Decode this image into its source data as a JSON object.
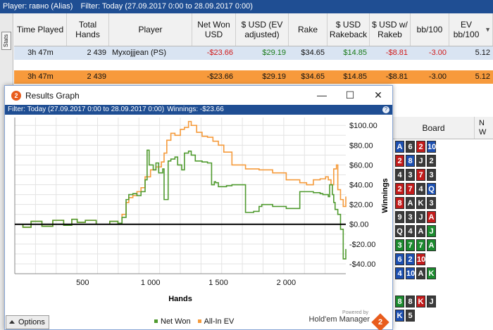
{
  "top_bar": {
    "player": "Player: гавно (Alias)",
    "filter": "Filter: Today (27.09.2017 0:00 to 28.09.2017 0:00)"
  },
  "side_tab": {
    "label": "Stats"
  },
  "stats_table": {
    "headers": [
      "Time Played",
      "Total Hands",
      "Player",
      "Net Won USD",
      "$ USD (EV adjusted)",
      "Rake",
      "$ USD Rakeback",
      "$ USD w/ Rakeb",
      "bb/100",
      "EV bb/100"
    ],
    "row": {
      "time": "3h 47m",
      "hands": "2 439",
      "player": "Myxojjjean (PS)",
      "net": "-$23.66",
      "ev": "$29.19",
      "rake": "$34.65",
      "rakeback": "$14.85",
      "with_rb": "-$8.81",
      "bb100": "-3.00",
      "evbb100": "5.12"
    },
    "total": {
      "time": "3h 47m",
      "hands": "2 439",
      "net": "-$23.66",
      "ev": "$29.19",
      "rake": "$34.65",
      "rakeback": "$14.85",
      "with_rb": "-$8.81",
      "bb100": "-3.00",
      "evbb100": "5.12"
    }
  },
  "board_panel": {
    "header": "Board",
    "header2": "N W",
    "rows": [
      [
        [
          "A",
          "d"
        ],
        [
          "6",
          "s"
        ],
        [
          "2",
          "h"
        ],
        [
          "10",
          "d"
        ]
      ],
      [
        [
          "2",
          "h"
        ],
        [
          "8",
          "d"
        ],
        [
          "J",
          "s"
        ],
        [
          "2",
          "s"
        ]
      ],
      [
        [
          "4",
          "s"
        ],
        [
          "3",
          "s"
        ],
        [
          "7",
          "h"
        ],
        [
          "3",
          "s"
        ]
      ],
      [
        [
          "2",
          "h"
        ],
        [
          "7",
          "h"
        ],
        [
          "4",
          "s"
        ],
        [
          "Q",
          "d"
        ]
      ],
      [
        [
          "8",
          "h"
        ],
        [
          "A",
          "s"
        ],
        [
          "K",
          "s"
        ],
        [
          "3",
          "s"
        ]
      ],
      [
        [
          "9",
          "s"
        ],
        [
          "3",
          "s"
        ],
        [
          "J",
          "s"
        ],
        [
          "A",
          "h"
        ]
      ],
      [
        [
          "Q",
          "s"
        ],
        [
          "4",
          "s"
        ],
        [
          "A",
          "s"
        ],
        [
          "J",
          "c"
        ]
      ],
      [
        [
          "3",
          "c"
        ],
        [
          "7",
          "c"
        ],
        [
          "7",
          "c"
        ],
        [
          "A",
          "c"
        ]
      ],
      [
        [
          "6",
          "d"
        ],
        [
          "2",
          "d"
        ],
        [
          "10",
          "h"
        ],
        [
          "",
          ""
        ]
      ],
      [
        [
          "4",
          "d"
        ],
        [
          "10",
          "d"
        ],
        [
          "A",
          "s"
        ],
        [
          "K",
          "c"
        ]
      ],
      [
        [
          "",
          ""
        ],
        [
          "",
          ""
        ],
        [
          "",
          ""
        ],
        [
          "",
          ""
        ]
      ],
      [
        [
          "8",
          "c"
        ],
        [
          "8",
          "s"
        ],
        [
          "K",
          "h"
        ],
        [
          "J",
          "s"
        ]
      ],
      [
        [
          "K",
          "d"
        ],
        [
          "5",
          "s"
        ],
        [
          "",
          ""
        ],
        [
          "",
          ""
        ]
      ]
    ]
  },
  "graph_window": {
    "title": "Results Graph",
    "filter": "Filter: Today (27.09.2017 0:00 to 28.09.2017 0:00)",
    "winnings": "Winnings: -$23.66",
    "help": "?",
    "controls": {
      "minimize": "—",
      "maximize": "☐",
      "close": "✕"
    },
    "options_label": "Options",
    "legend": {
      "net_won": "Net Won",
      "all_in_ev": "All-In EV"
    },
    "powered_by": "Powered by",
    "brand": "Hold'em Manager",
    "colors": {
      "net_won": "#4f9a2e",
      "all_in_ev": "#f59a3a"
    }
  },
  "chart_data": {
    "type": "line",
    "xlabel": "Hands",
    "ylabel": "Winnings",
    "xlim": [
      0,
      2439
    ],
    "ylim": [
      -50,
      108
    ],
    "x_ticks": [
      500,
      1000,
      1500,
      2000
    ],
    "x_tick_labels": [
      "500",
      "1 000",
      "1 500",
      "2 000"
    ],
    "y_ticks": [
      -40,
      -20,
      0,
      20,
      40,
      60,
      80,
      100
    ],
    "y_tick_labels": [
      "-$40.00",
      "-$20.00",
      "$0.00",
      "$20.00",
      "$40.00",
      "$60.00",
      "$80.00",
      "$100.00"
    ],
    "series": [
      {
        "name": "Net Won",
        "color": "#4f9a2e",
        "x": [
          0,
          60,
          120,
          200,
          280,
          360,
          420,
          460,
          520,
          600,
          700,
          760,
          790,
          820,
          840,
          870,
          900,
          930,
          960,
          975,
          990,
          1000,
          1020,
          1040,
          1060,
          1090,
          1100,
          1130,
          1150,
          1180,
          1200,
          1230,
          1250,
          1280,
          1300,
          1330,
          1380,
          1420,
          1450,
          1470,
          1480,
          1500,
          1540,
          1560,
          1600,
          1640,
          1700,
          1760,
          1800,
          1820,
          1900,
          2000,
          2100,
          2200,
          2250,
          2270,
          2290,
          2310,
          2320,
          2340,
          2350,
          2360,
          2380,
          2400,
          2420,
          2439
        ],
        "values": [
          0,
          -3,
          3,
          -2,
          4,
          -1,
          5,
          2,
          4,
          0,
          3,
          1,
          7,
          25,
          30,
          31,
          29,
          33,
          45,
          75,
          60,
          60,
          55,
          62,
          52,
          56,
          25,
          64,
          66,
          68,
          60,
          55,
          72,
          74,
          70,
          64,
          63,
          62,
          40,
          43,
          42,
          38,
          38,
          39,
          40,
          40,
          12,
          13,
          18,
          20,
          18,
          16,
          33,
          32,
          31,
          30,
          30,
          28,
          40,
          30,
          22,
          15,
          10,
          -5,
          -35,
          -25
        ]
      },
      {
        "name": "All-In EV",
        "color": "#f59a3a",
        "x": [
          0,
          60,
          120,
          200,
          280,
          360,
          420,
          460,
          520,
          600,
          700,
          760,
          790,
          820,
          840,
          870,
          900,
          930,
          960,
          1000,
          1040,
          1080,
          1100,
          1120,
          1150,
          1180,
          1220,
          1250,
          1280,
          1300,
          1340,
          1380,
          1420,
          1460,
          1500,
          1540,
          1600,
          1700,
          1800,
          1900,
          2000,
          2100,
          2150,
          2200,
          2250,
          2290,
          2310,
          2330,
          2350,
          2370,
          2380,
          2400,
          2420,
          2439
        ],
        "values": [
          0,
          -3,
          3,
          -2,
          4,
          -1,
          5,
          2,
          4,
          0,
          3,
          1,
          10,
          22,
          27,
          29,
          33,
          37,
          48,
          55,
          58,
          63,
          72,
          85,
          92,
          90,
          96,
          98,
          104,
          100,
          93,
          89,
          88,
          84,
          80,
          73,
          60,
          56,
          55,
          52,
          45,
          42,
          40,
          45,
          46,
          48,
          45,
          40,
          56,
          60,
          35,
          25,
          18,
          28
        ]
      }
    ],
    "grid": true,
    "legend_position": "bottom-center",
    "zero_line": true
  }
}
